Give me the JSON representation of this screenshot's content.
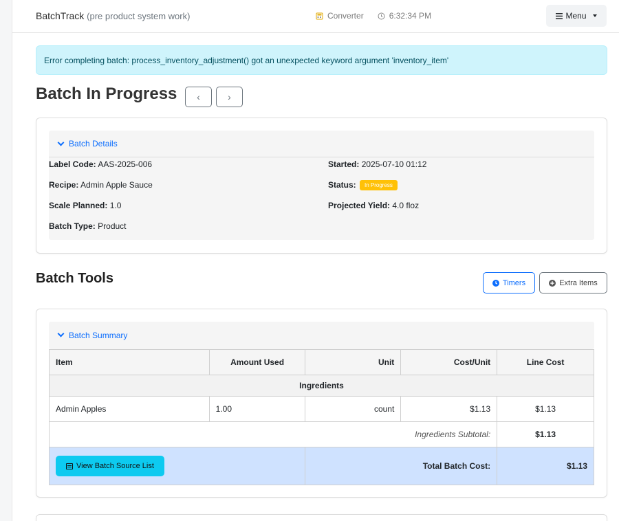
{
  "nav": {
    "brand": "BatchTrack",
    "brand_sub": "(pre product system work)",
    "converter_label": "Converter",
    "clock": "6:32:34 PM",
    "menu_label": "Menu",
    "menu_icon": "hamburger-icon"
  },
  "alert": {
    "message": "Error completing batch: process_inventory_adjustment() got an unexpected keyword argument 'inventory_item'"
  },
  "page": {
    "title": "Batch In Progress",
    "prev_label": "‹",
    "next_label": "›"
  },
  "details": {
    "header": "Batch Details",
    "label_code_label": "Label Code:",
    "label_code": "AAS-2025-006",
    "recipe_label": "Recipe:",
    "recipe": "Admin Apple Sauce",
    "scale_label": "Scale Planned:",
    "scale": "1.0",
    "type_label": "Batch Type:",
    "type": "Product",
    "started_label": "Started:",
    "started": "2025-07-10 01:12",
    "status_label": "Status:",
    "status": "In Progress",
    "yield_label": "Projected Yield:",
    "yield": "4.0 floz",
    "status_color": "#ffc107"
  },
  "tools": {
    "title": "Batch Tools",
    "timers_label": "Timers",
    "extra_label": "Extra Items"
  },
  "summary": {
    "header": "Batch Summary",
    "columns": [
      "Item",
      "Amount Used",
      "Unit",
      "Cost/Unit",
      "Line Cost"
    ],
    "group": "Ingredients",
    "rows": [
      [
        "Admin Apples",
        "1.00",
        "count",
        "$1.13",
        "$1.13"
      ]
    ],
    "subtotal_label": "Ingredients Subtotal:",
    "subtotal": "$1.13",
    "source_button": "View Batch Source List",
    "total_label": "Total Batch Cost:",
    "total": "$1.13"
  },
  "colors": {
    "accent": "#0d6efd",
    "alert_bg": "#cff4fc",
    "total_bg": "#cfe2ff",
    "info_button": "#0dcaf0"
  }
}
